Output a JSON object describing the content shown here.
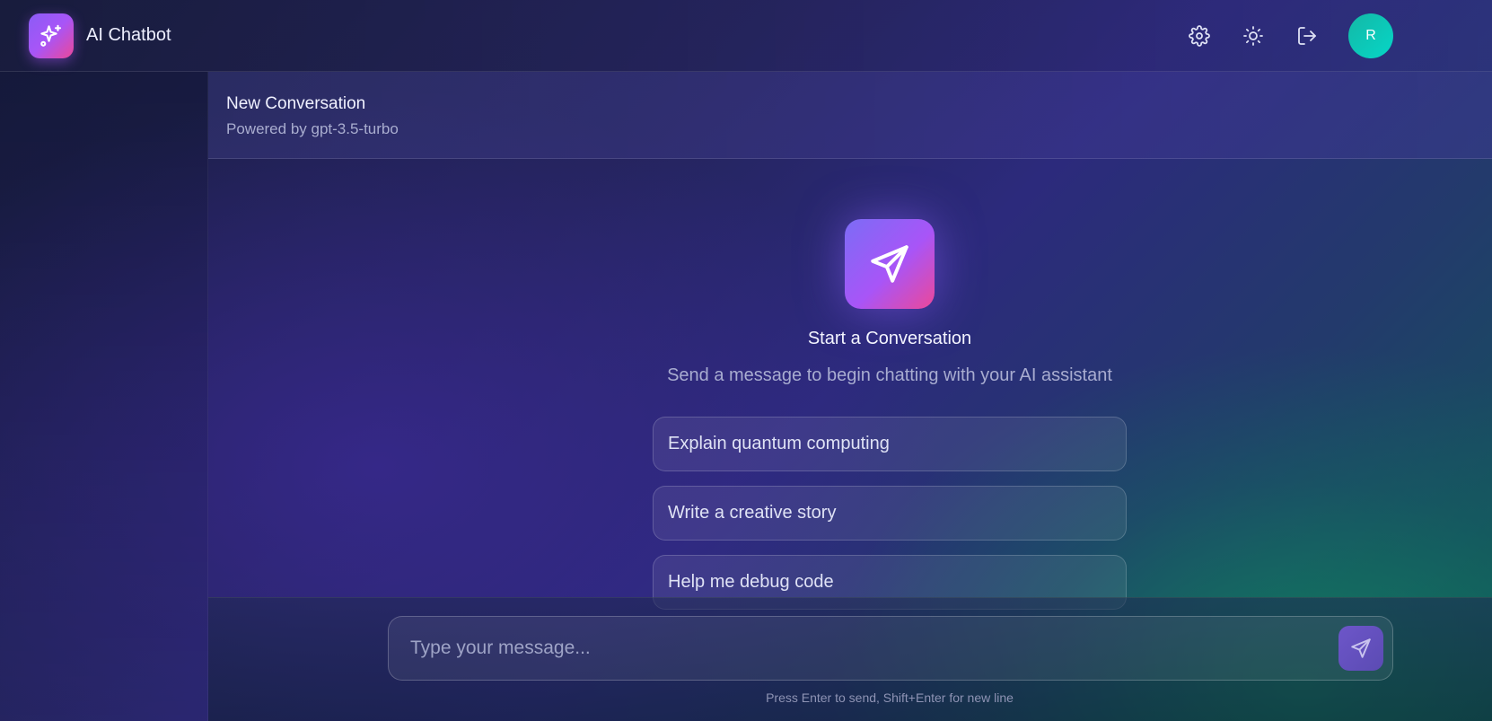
{
  "header": {
    "app_title": "AI Chatbot",
    "logo_icon": "sparkles-icon",
    "actions": [
      {
        "name": "settings",
        "icon": "gear-icon"
      },
      {
        "name": "theme",
        "icon": "sun-icon"
      },
      {
        "name": "logout",
        "icon": "logout-icon"
      }
    ],
    "avatar_initial": "R"
  },
  "conversation": {
    "title": "New Conversation",
    "subtitle": "Powered by gpt-3.5-turbo"
  },
  "empty_state": {
    "icon": "send-icon",
    "title": "Start a Conversation",
    "subtitle": "Send a message to begin chatting with your AI assistant",
    "suggestions": [
      "Explain quantum computing",
      "Write a creative story",
      "Help me debug code"
    ]
  },
  "composer": {
    "placeholder": "Type your message...",
    "value": "",
    "hint": "Press Enter to send, Shift+Enter for new line",
    "send_icon": "send-icon"
  },
  "colors": {
    "accent_start": "#8b5cf6",
    "accent_end": "#ec4899",
    "avatar": "#14b8a6"
  }
}
